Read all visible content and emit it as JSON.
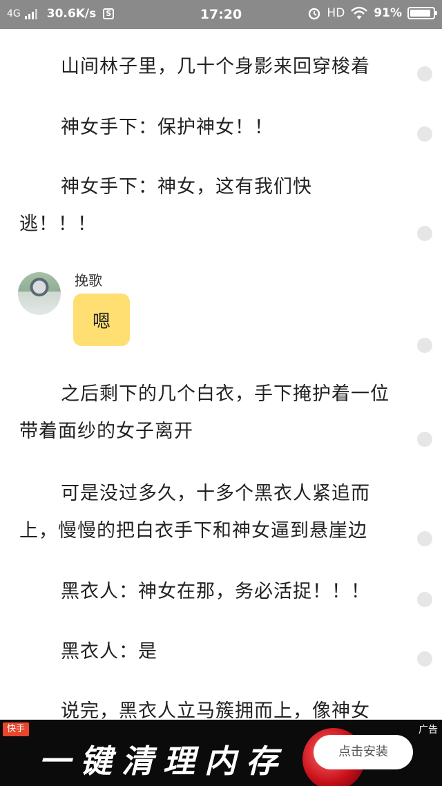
{
  "status_bar": {
    "network": "4G",
    "speed": "30.6K/s",
    "speed_badge": "S",
    "time": "17:20",
    "hd": "HD",
    "battery_percent": "91%",
    "battery_level": 0.91
  },
  "story": {
    "paragraphs": [
      "山间林子里，几十个身影来回穿梭着",
      "神女手下：保护神女！！",
      "神女手下：神女，这有我们快逃！！！",
      "之后剩下的几个白衣，手下掩护着一位带着面纱的女子离开",
      "可是没过多久，十多个黑衣人紧追而上，慢慢的把白衣手下和神女逼到悬崖边",
      "黑衣人：神女在那，务必活捉！！！",
      "黑衣人：是",
      "说完，黑衣人立马簇拥而上，像神女"
    ],
    "chat": {
      "speaker": "挽歌",
      "message": "嗯"
    }
  },
  "ad": {
    "brand": "快手",
    "tag": "广告",
    "title": "一键清理内存",
    "button": "点击安装"
  }
}
